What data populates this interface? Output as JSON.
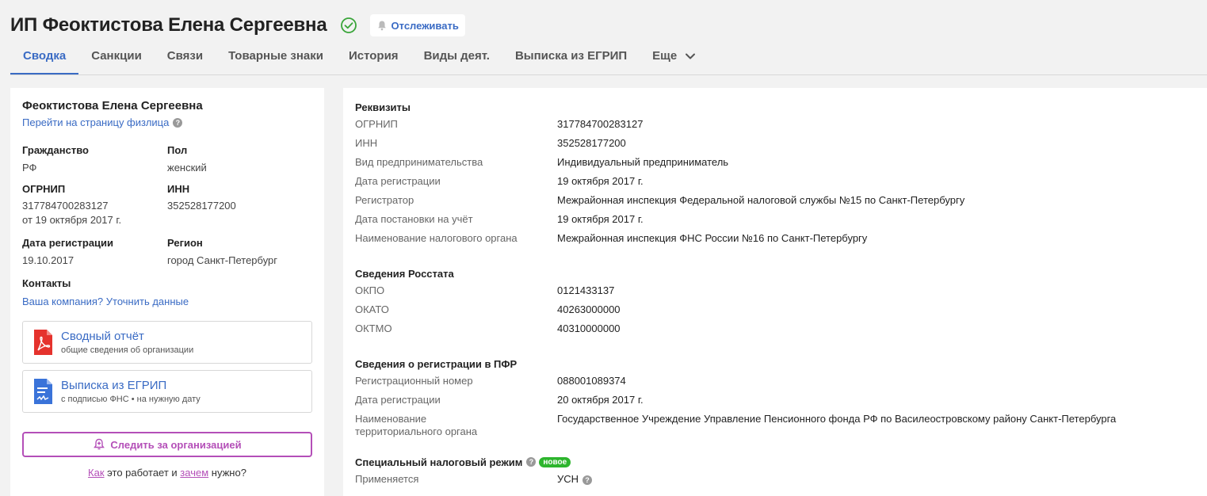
{
  "header": {
    "title": "ИП Феоктистова Елена Сергеевна",
    "track_label": "Отслеживать"
  },
  "tabs": [
    {
      "label": "Сводка"
    },
    {
      "label": "Санкции"
    },
    {
      "label": "Связи"
    },
    {
      "label": "Товарные знаки"
    },
    {
      "label": "История"
    },
    {
      "label": "Виды деят."
    },
    {
      "label": "Выписка из ЕГРИП"
    },
    {
      "label": "Еще"
    }
  ],
  "left": {
    "name": "Феоктистова Елена Сергеевна",
    "person_link": "Перейти на страницу физлица",
    "citizenship_label": "Гражданство",
    "citizenship_value": "РФ",
    "sex_label": "Пол",
    "sex_value": "женский",
    "ogrnip_label": "ОГРНИП",
    "ogrnip_value": "317784700283127",
    "ogrnip_date": "от 19 октября 2017 г.",
    "inn_label": "ИНН",
    "inn_value": "352528177200",
    "regdate_label": "Дата регистрации",
    "regdate_value": "19.10.2017",
    "region_label": "Регион",
    "region_value": "город Санкт-Петербург",
    "contacts_label": "Контакты",
    "contacts_link": "Ваша компания? Уточнить данные",
    "report_title": "Сводный отчёт",
    "report_sub": "общие сведения об организации",
    "egrip_title": "Выписка из ЕГРИП",
    "egrip_sub": "с подписью ФНС • на нужную дату",
    "follow_label": "Следить за организацией",
    "how_1": "Как",
    "how_2": " это работает и ",
    "how_3": "зачем",
    "how_4": " нужно?"
  },
  "right": {
    "requisites": {
      "title": "Реквизиты",
      "rows": [
        {
          "k": "ОГРНИП",
          "v": "317784700283127"
        },
        {
          "k": "ИНН",
          "v": "352528177200"
        },
        {
          "k": "Вид предпринимательства",
          "v": "Индивидуальный предприниматель"
        },
        {
          "k": "Дата регистрации",
          "v": "19 октября 2017 г."
        },
        {
          "k": "Регистратор",
          "v": "Межрайонная инспекция Федеральной налоговой службы №15 по Санкт-Петербургу"
        },
        {
          "k": "Дата постановки на учёт",
          "v": "19 октября 2017 г."
        },
        {
          "k": "Наименование налогового органа",
          "v": "Межрайонная инспекция ФНС России №16 по Санкт-Петербургу"
        }
      ]
    },
    "rosstat": {
      "title": "Сведения Росстата",
      "rows": [
        {
          "k": "ОКПО",
          "v": "0121433137"
        },
        {
          "k": "ОКАТО",
          "v": "40263000000"
        },
        {
          "k": "ОКТМО",
          "v": "40310000000"
        }
      ]
    },
    "pfr": {
      "title": "Сведения о регистрации в ПФР",
      "rows": [
        {
          "k": "Регистрационный номер",
          "v": "088001089374"
        },
        {
          "k": "Дата регистрации",
          "v": "20 октября 2017 г."
        },
        {
          "k": "Наименование территориального органа",
          "v": "Государственное Учреждение Управление Пенсионного фонда РФ по Василеостровскому району Санкт-Петербурга"
        }
      ]
    },
    "tax": {
      "title": "Специальный налоговый режим",
      "badge": "новое",
      "applied_label": "Применяется",
      "applied_value": "УСН"
    }
  },
  "colors": {
    "accent": "#3a6bc4",
    "follow": "#b44fb8",
    "new_badge": "#2db52d",
    "verified": "#3aa53a"
  }
}
